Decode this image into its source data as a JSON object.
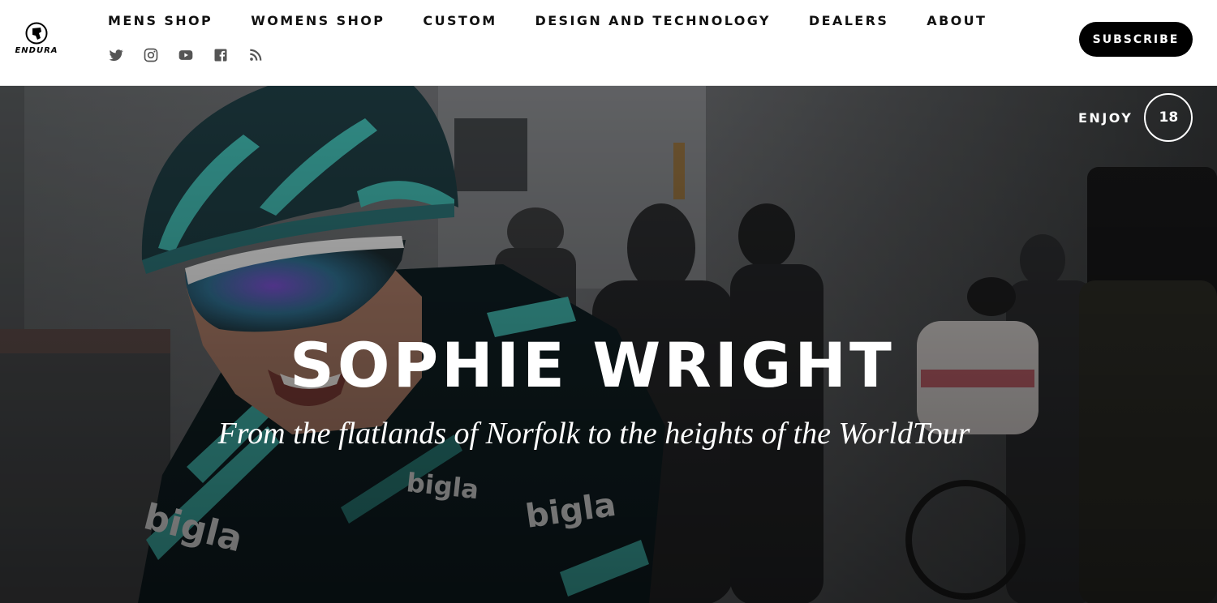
{
  "brand": {
    "name": "ENDURA"
  },
  "nav": {
    "items": [
      {
        "label": "MENS SHOP"
      },
      {
        "label": "WOMENS SHOP"
      },
      {
        "label": "CUSTOM"
      },
      {
        "label": "DESIGN AND TECHNOLOGY"
      },
      {
        "label": "DEALERS"
      },
      {
        "label": "ABOUT"
      }
    ]
  },
  "social": [
    {
      "icon": "twitter-icon"
    },
    {
      "icon": "instagram-icon"
    },
    {
      "icon": "youtube-icon"
    },
    {
      "icon": "facebook-icon"
    },
    {
      "icon": "rss-icon"
    }
  ],
  "header": {
    "subscribe_label": "SUBSCRIBE"
  },
  "hero": {
    "title": "SOPHIE WRIGHT",
    "subtitle": "From the flatlands of Norfolk to the heights of the WorldTour",
    "enjoy_label": "ENJOY",
    "enjoy_count": "18",
    "jersey_text": "bigla"
  },
  "colors": {
    "accent_teal": "#3fb1a9",
    "button_bg": "#000000",
    "text_dark": "#111111"
  }
}
